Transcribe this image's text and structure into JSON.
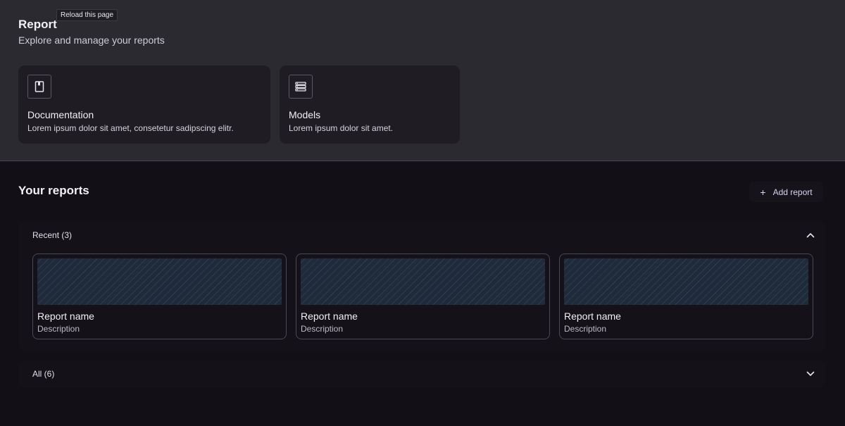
{
  "tooltip": "Reload this page",
  "header": {
    "title": "Report",
    "subtitle": "Explore and manage your reports"
  },
  "info_cards": [
    {
      "title": "Documentation",
      "description": "Lorem ipsum dolor sit amet, consetetur sadipscing elitr.",
      "icon": "book-icon"
    },
    {
      "title": "Models",
      "description": "Lorem ipsum dolor sit amet.",
      "icon": "database-icon"
    }
  ],
  "reports": {
    "title": "Your reports",
    "add_label": "Add report",
    "recent": {
      "label": "Recent (3)",
      "expanded": true,
      "items": [
        {
          "name": "Report name",
          "description": "Description"
        },
        {
          "name": "Report name",
          "description": "Description"
        },
        {
          "name": "Report name",
          "description": "Description"
        }
      ]
    },
    "all": {
      "label": "All (6)",
      "expanded": false
    }
  },
  "colors": {
    "header_bg": "#2c2a31",
    "page_bg": "#121016",
    "card_bg": "#1f1d23",
    "accent_text": "#d9d2f0",
    "thumbnail": "#1f2b3a"
  }
}
